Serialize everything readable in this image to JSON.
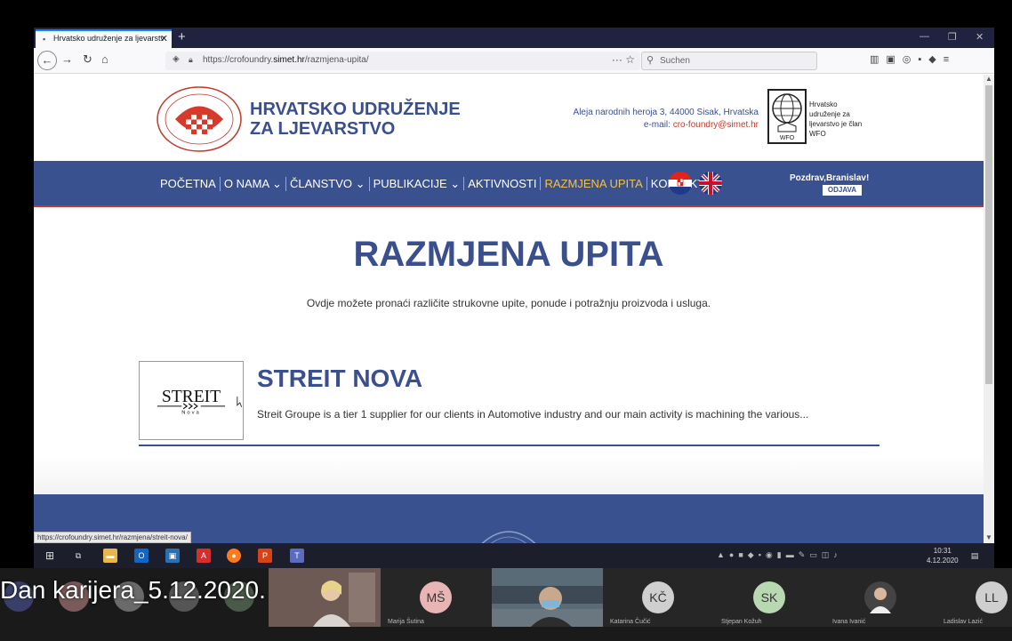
{
  "browser": {
    "tab_title": "Hrvatsko udruženje za ljevarstv",
    "url_prefix": "https://crofoundry.",
    "url_domain": "simet.hr",
    "url_path": "/razmjena-upita/",
    "search_placeholder": "Suchen"
  },
  "header": {
    "title_line1": "HRVATSKO UDRUŽENJE",
    "title_line2": "ZA LJEVARSTVO",
    "address": "Aleja narodnih heroja 3, 44000 Sisak, Hrvatska",
    "email_label": "e-mail:",
    "email": "cro-foundry@simet.hr",
    "wfo_text": "Hrvatsko udruženje za ljevarstvo je član WFO",
    "wfo_label": "WFO"
  },
  "nav": {
    "items": [
      "POČETNA",
      "O NAMA",
      "ČLANSTVO",
      "PUBLIKACIJE",
      "AKTIVNOSTI",
      "RAZMJENA UPITA",
      "KONTAKT"
    ],
    "greeting": "Pozdrav,Branislav!",
    "logout": "ODJAVA"
  },
  "main": {
    "title": "RAZMJENA UPITA",
    "subtitle": "Ovdje možete pronaći različite strukovne upite, ponude i potražnju proizvoda i usluga."
  },
  "listing": {
    "logo_text": "STREIT",
    "logo_sub": "Nova",
    "title": "STREIT NOVA",
    "description": "Streit Groupe is a tier 1 supplier for our clients in Automotive industry and our main activity is machining the various..."
  },
  "status_link": "https://crofoundry.simet.hr/razmjena/streit-nova/",
  "clock": {
    "time": "10:31",
    "date": "4.12.2020"
  },
  "participants": [
    {
      "initials": "MŠ",
      "name": "Marija Šutina",
      "color": "#e8b4b4"
    },
    {
      "initials": "KČ",
      "name": "Katarina Čučić",
      "color": "#cfcfcf"
    },
    {
      "initials": "SK",
      "name": "Stjepan Kožuh",
      "color": "#b7d8b0"
    },
    {
      "initials": "",
      "name": "Ivana Ivanić",
      "color": "#444444"
    },
    {
      "initials": "LL",
      "name": "Ladislav Lazić",
      "color": "#cfcfcf"
    }
  ],
  "caption": "Dan karijera_5.12.2020.",
  "colors": {
    "brand": "#3a5190",
    "accent": "#c0392b",
    "active": "#f6c142"
  }
}
